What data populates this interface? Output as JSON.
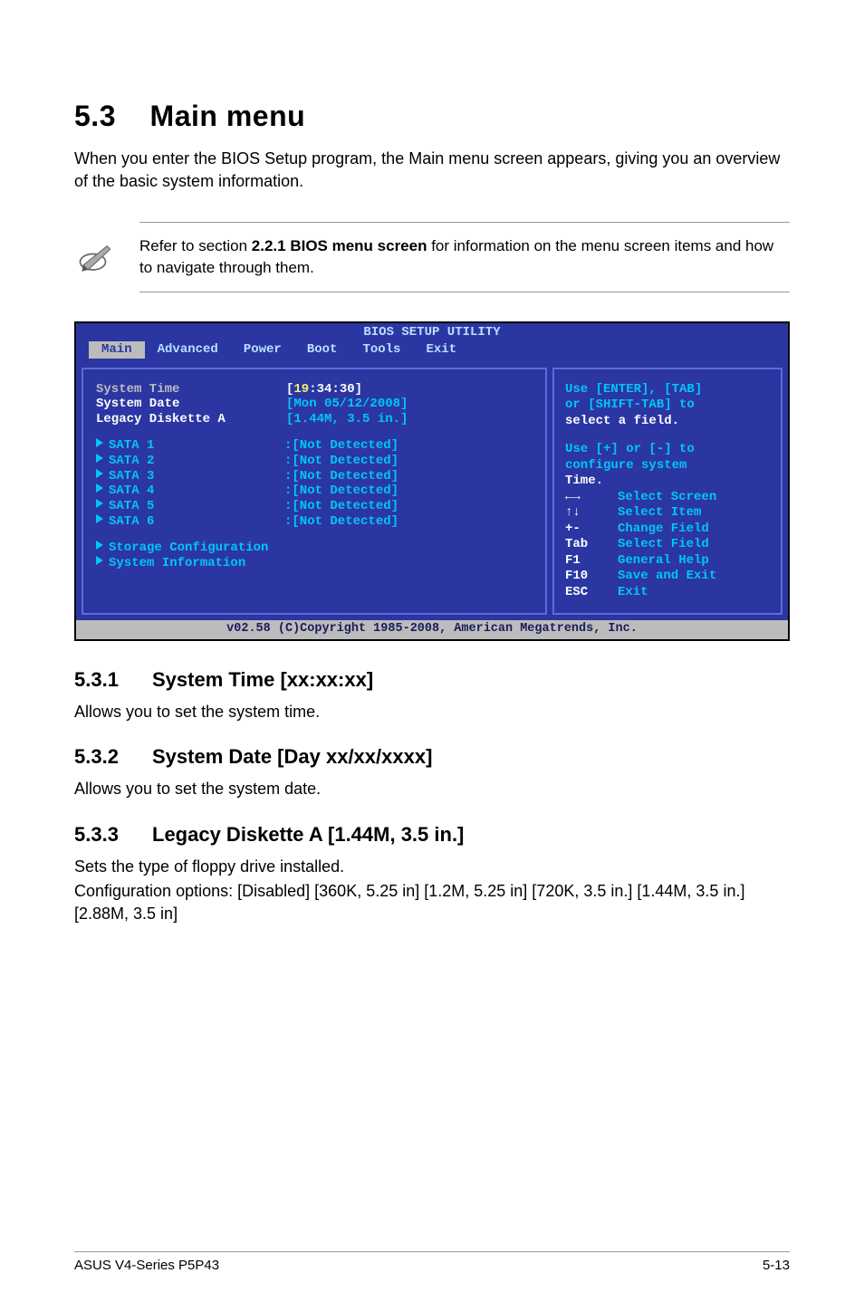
{
  "heading": {
    "number": "5.3",
    "title": "Main menu"
  },
  "lead": "When you enter the BIOS Setup program, the Main menu screen appears, giving you an overview of the basic system information.",
  "note": {
    "prefix": "Refer to section ",
    "bold": "2.2.1  BIOS menu screen",
    "suffix": " for information on the menu screen items and how to navigate through them."
  },
  "bios": {
    "title": "BIOS SETUP UTILITY",
    "tabs": [
      "Main",
      "Advanced",
      "Power",
      "Boot",
      "Tools",
      "Exit"
    ],
    "active_tab": "Main",
    "fields": {
      "system_time_label": "System Time",
      "system_time_value_open": "[",
      "system_time_hour": "19",
      "system_time_rest": ":34:30]",
      "system_date_label": "System Date",
      "system_date_value": "[Mon 05/12/2008]",
      "diskette_label": "Legacy Diskette A",
      "diskette_value": "[1.44M, 3.5 in.]"
    },
    "sata": [
      {
        "label": "SATA 1",
        "value": ":[Not Detected]"
      },
      {
        "label": "SATA 2",
        "value": ":[Not Detected]"
      },
      {
        "label": "SATA 3",
        "value": ":[Not Detected]"
      },
      {
        "label": "SATA 4",
        "value": ":[Not Detected]"
      },
      {
        "label": "SATA 5",
        "value": ":[Not Detected]"
      },
      {
        "label": "SATA 6",
        "value": ":[Not Detected]"
      }
    ],
    "menus": {
      "storage": "Storage Configuration",
      "sysinfo": "System Information"
    },
    "help_top_line1": "Use [ENTER], [TAB]",
    "help_top_line2": "or [SHIFT-TAB] to",
    "help_top_line3": "select a field.",
    "help_top_line4": "Use [+] or [-] to",
    "help_top_line5": "configure system",
    "help_top_line6": "Time.",
    "keys": [
      {
        "k": "←→",
        "d": "Select Screen",
        "whitekey": true
      },
      {
        "k": "↑↓",
        "d": "Select Item",
        "whitekey": true
      },
      {
        "k": "+-",
        "d": "Change Field"
      },
      {
        "k": "Tab",
        "d": "Select Field"
      },
      {
        "k": "F1",
        "d": "General Help"
      },
      {
        "k": "F10",
        "d": "Save and Exit"
      },
      {
        "k": "ESC",
        "d": "Exit"
      }
    ],
    "footer": "v02.58 (C)Copyright 1985-2008, American Megatrends, Inc."
  },
  "sections": {
    "s1": {
      "num": "5.3.1",
      "title": "System Time [xx:xx:xx]",
      "body": "Allows you to set the system time."
    },
    "s2": {
      "num": "5.3.2",
      "title": "System Date [Day xx/xx/xxxx]",
      "body": "Allows you to set the system date."
    },
    "s3": {
      "num": "5.3.3",
      "title": "Legacy Diskette A [1.44M, 3.5 in.]",
      "body1": "Sets the type of floppy drive installed.",
      "body2": "Configuration options: [Disabled] [360K, 5.25 in] [1.2M, 5.25 in] [720K, 3.5 in.] [1.44M, 3.5 in.] [2.88M, 3.5 in]"
    }
  },
  "footer": {
    "left": "ASUS V4-Series P5P43",
    "right": "5-13"
  }
}
